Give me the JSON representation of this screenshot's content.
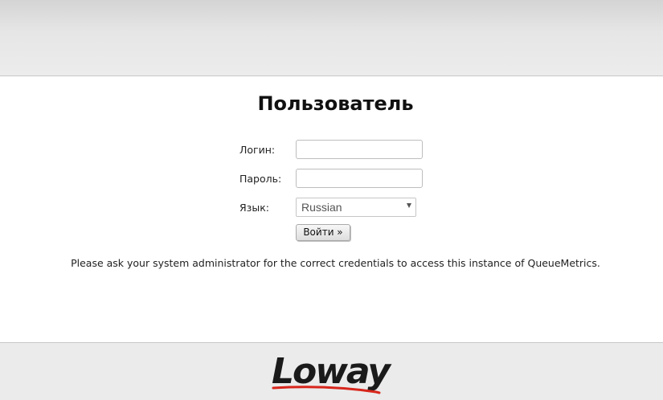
{
  "login_panel": {
    "title": "Пользователь",
    "username_label": "Логин:",
    "username_value": "",
    "password_label": "Пароль:",
    "password_value": "",
    "language_label": "Язык:",
    "language_selected": "Russian",
    "submit_label": "Войти »",
    "notice": "Please ask your system administrator for the correct credentials to access this instance of QueueMetrics."
  },
  "footer": {
    "logo_text": "Loway"
  },
  "colors": {
    "logo_text": "#1a1a1a",
    "logo_swoosh": "#d8261c"
  }
}
